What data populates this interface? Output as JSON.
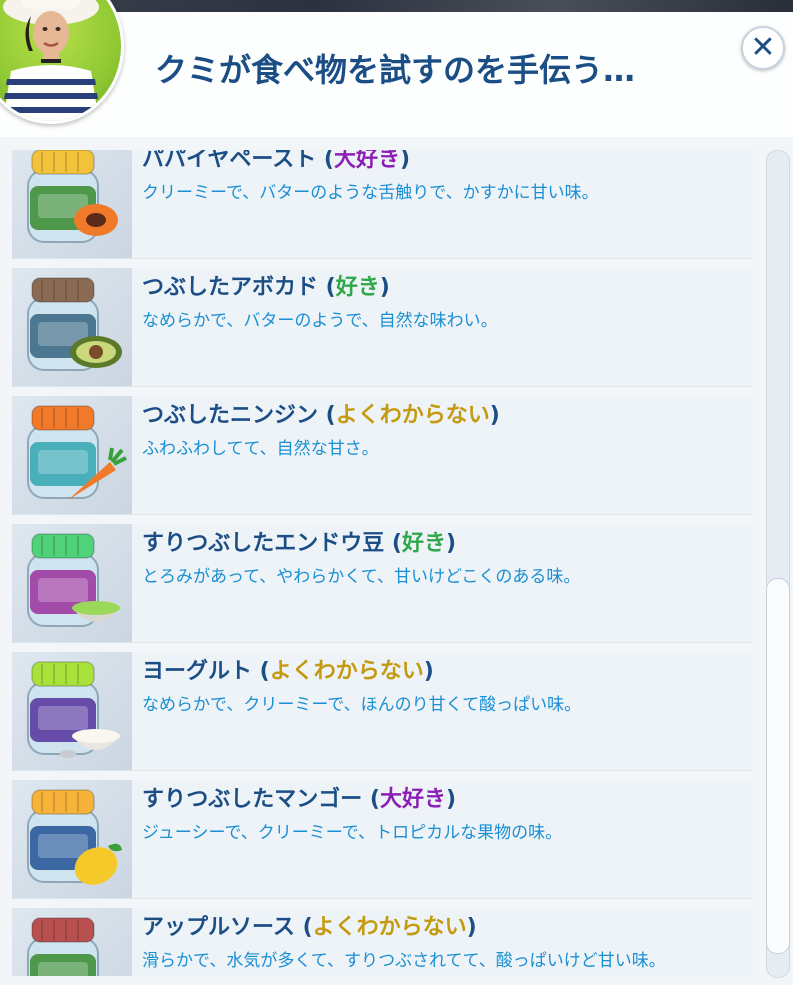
{
  "dialog": {
    "title": "クミが食べ物を試すのを手伝う…",
    "close_icon": "close-icon",
    "close_symbol": "✕"
  },
  "colors": {
    "title": "#1c4e86",
    "description": "#1a8fd4",
    "love": "#8c1fb5",
    "like": "#2fa84a",
    "unsure": "#c49a10"
  },
  "foods": [
    {
      "name": "パパイヤペースト",
      "pref": "大好き",
      "pref_type": "love",
      "desc": "クリーミーで、バターのような舌触りで、かすかに甘い味。",
      "lid": "#f2c23a",
      "body": "#3f8f3a",
      "icon": "papaya-icon"
    },
    {
      "name": "つぶしたアボカド",
      "pref": "好き",
      "pref_type": "like",
      "desc": "なめらかで、バターのようで、自然な味わい。",
      "lid": "#8a6a52",
      "body": "#3c6a86",
      "icon": "avocado-icon"
    },
    {
      "name": "つぶしたニンジン",
      "pref": "よくわからない",
      "pref_type": "unsure",
      "desc": "ふわふわしてて、自然な甘さ。",
      "lid": "#f07a2a",
      "body": "#3aa8b5",
      "icon": "carrot-icon"
    },
    {
      "name": "すりつぶしたエンドウ豆",
      "pref": "好き",
      "pref_type": "like",
      "desc": "とろみがあって、やわらかくて、甘いけどこくのある味。",
      "lid": "#4fd27a",
      "body": "#9c3aa0",
      "icon": "pea-bowl-icon"
    },
    {
      "name": "ヨーグルト",
      "pref": "よくわからない",
      "pref_type": "unsure",
      "desc": "なめらかで、クリーミーで、ほんのり甘くて酸っぱい味。",
      "lid": "#a8e23a",
      "body": "#5a3aa0",
      "icon": "yogurt-bowl-icon"
    },
    {
      "name": "すりつぶしたマンゴー",
      "pref": "大好き",
      "pref_type": "love",
      "desc": "ジューシーで、クリーミーで、トロピカルな果物の味。",
      "lid": "#f7b23a",
      "body": "#2a5a9a",
      "icon": "mango-icon"
    },
    {
      "name": "アップルソース",
      "pref": "よくわからない",
      "pref_type": "unsure",
      "desc": "滑らかで、水気が多くて、すりつぶされてて、酸っぱいけど甘い味。",
      "lid": "#b85050",
      "body": "#3f8f3a",
      "icon": "apple-icon"
    }
  ],
  "scroll": {
    "position_fraction": 0.52,
    "visible_fraction": 0.45
  }
}
